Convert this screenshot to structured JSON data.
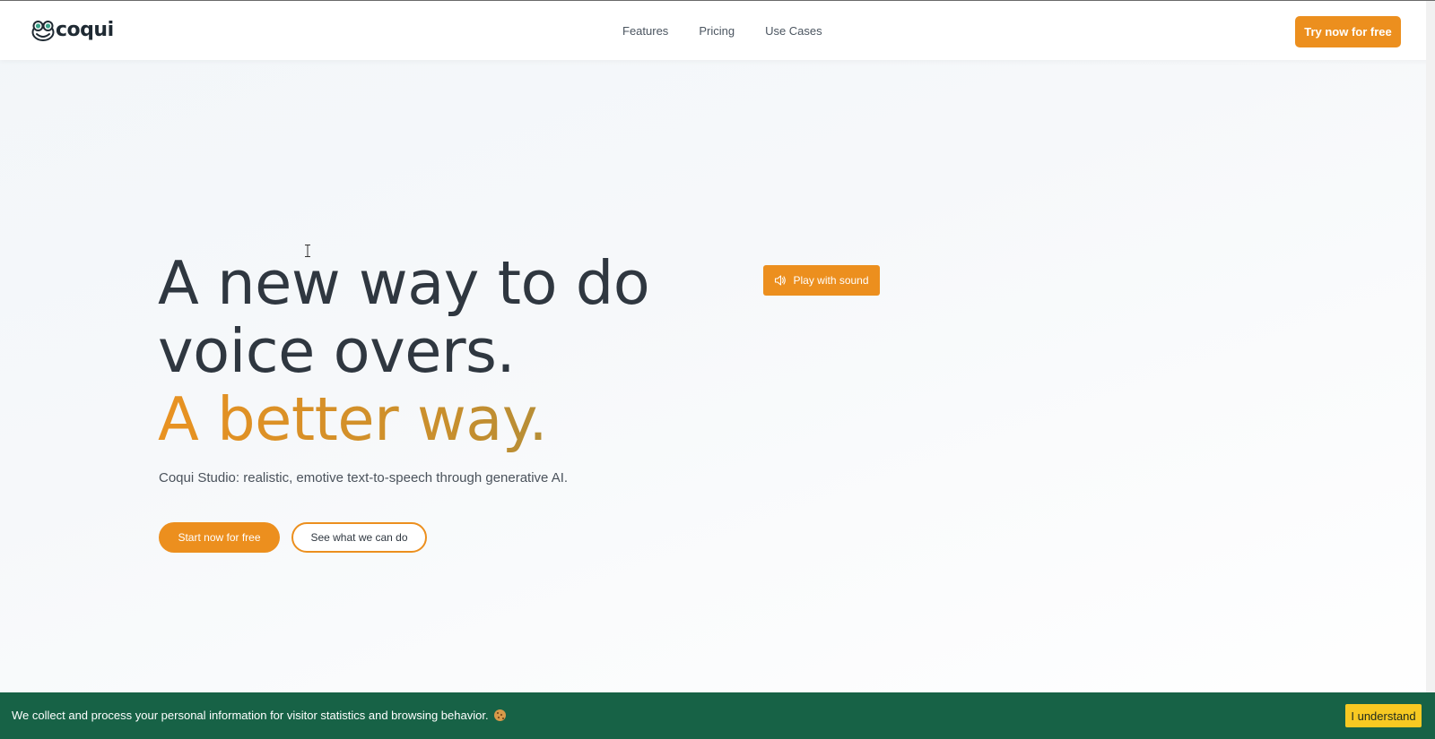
{
  "header": {
    "logo_text": "coqui",
    "nav": [
      {
        "label": "Features"
      },
      {
        "label": "Pricing"
      },
      {
        "label": "Use Cases"
      }
    ],
    "cta_label": "Try now for free"
  },
  "hero": {
    "title_line1": "A new way to do",
    "title_line2": "voice overs.",
    "title_accent": "A better way.",
    "subtitle": "Coqui Studio: realistic, emotive text-to-speech through generative AI.",
    "primary_button": "Start now for free",
    "secondary_button": "See what we can do",
    "play_button": "Play with sound"
  },
  "cookie_banner": {
    "message": "We collect and process your personal information for visitor statistics and browsing behavior.",
    "emoji_icon": "cookie-icon",
    "accept_label": "I understand"
  },
  "colors": {
    "accent": "#ec8f1e",
    "cookie_bar_bg": "#176246",
    "cookie_button_bg": "#f7c922",
    "text_dark": "#2f3740"
  }
}
